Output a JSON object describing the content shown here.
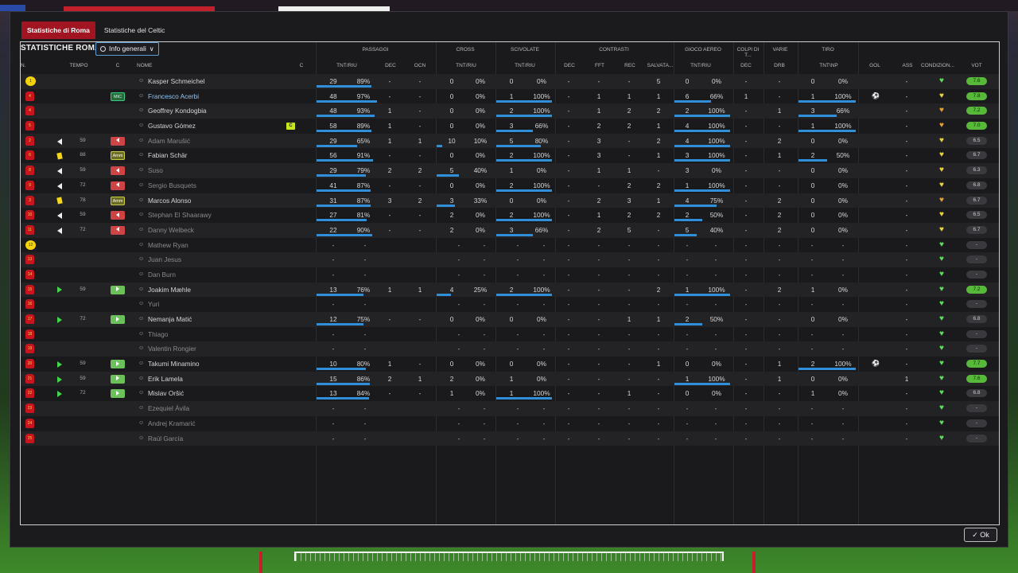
{
  "tabs": [
    {
      "label": "Statistiche di Roma",
      "active": true
    },
    {
      "label": "Statistiche del Celtic",
      "active": false
    }
  ],
  "panel_title": "STATISTICHE ROMA",
  "dropdown_label": "Info generali",
  "groups": {
    "passaggi": "PASSAGGI",
    "cross": "CROSS",
    "scivolate": "SCIVOLATE",
    "contrasti": "CONTRASTI",
    "gioco_aereo": "GIOCO AEREO",
    "colpi": "COLPI DI T...",
    "varie": "VARIE",
    "tiro": "TIRO"
  },
  "columns": {
    "n": "N.",
    "tempo": "TEMPO",
    "c1": "C",
    "nome": "NOME",
    "c2": "C",
    "pas_tnt": "TNT/RIU",
    "pas_dec": "DEC",
    "pas_ocn": "OCN",
    "cross_tnt": "TNT/RIU",
    "sciv_tnt": "TNT/RIU",
    "con_dec": "DEC",
    "con_fft": "FFT",
    "con_rec": "REC",
    "con_salv": "SALVATA...",
    "aer_tnt": "TNT/RIU",
    "colpi_dec": "DEC",
    "varie_drb": "DRB",
    "tiro_tnt": "TNT\\NP",
    "gol": "GOL",
    "ass": "ASS",
    "cond": "CONDIZION...",
    "vot": "VOT"
  },
  "players": [
    {
      "num": "1",
      "gk": true,
      "ev": "",
      "min": "",
      "role": "",
      "name": "Kasper Schmeichel",
      "style": "",
      "cap": "",
      "pas": "29",
      "pasP": "89%",
      "pasFrac": 0.89,
      "pdec": "-",
      "pocn": "-",
      "cr": "0",
      "crP": "0%",
      "crFrac": 0,
      "sc": "0",
      "scP": "0%",
      "scFrac": 0,
      "cdec": "-",
      "fft": "-",
      "rec": "-",
      "salv": "5",
      "aer": "0",
      "aerP": "0%",
      "aerFrac": 0,
      "hdec": "-",
      "drb": "-",
      "tiro": "0",
      "tiroP": "0%",
      "tiroFrac": 0,
      "gol": "",
      "ass": "-",
      "cond": "grn",
      "vot": "7.6",
      "good": true
    },
    {
      "num": "4",
      "gk": false,
      "ev": "",
      "min": "",
      "role": "MIC",
      "roleType": "pos",
      "name": "Francesco Acerbi",
      "style": "link",
      "cap": "",
      "pas": "48",
      "pasP": "97%",
      "pasFrac": 0.97,
      "pdec": "-",
      "pocn": "-",
      "cr": "0",
      "crP": "0%",
      "crFrac": 0,
      "sc": "1",
      "scP": "100%",
      "scFrac": 1,
      "cdec": "-",
      "fft": "1",
      "rec": "1",
      "salv": "1",
      "aer": "6",
      "aerP": "66%",
      "aerFrac": 0.66,
      "hdec": "1",
      "drb": "-",
      "tiro": "1",
      "tiroP": "100%",
      "tiroFrac": 1,
      "gol": "ball",
      "ass": "-",
      "cond": "yel",
      "vot": "7.8",
      "good": true
    },
    {
      "num": "4",
      "gk": false,
      "ev": "",
      "min": "",
      "role": "",
      "name": "Geoffrey Kondogbia",
      "style": "",
      "cap": "",
      "pas": "48",
      "pasP": "93%",
      "pasFrac": 0.93,
      "pdec": "1",
      "pocn": "-",
      "cr": "0",
      "crP": "0%",
      "crFrac": 0,
      "sc": "2",
      "scP": "100%",
      "scFrac": 1,
      "cdec": "-",
      "fft": "1",
      "rec": "2",
      "salv": "2",
      "aer": "2",
      "aerP": "100%",
      "aerFrac": 1,
      "hdec": "-",
      "drb": "1",
      "tiro": "3",
      "tiroP": "66%",
      "tiroFrac": 0.66,
      "gol": "",
      "ass": "-",
      "cond": "org",
      "vot": "7.2",
      "good": true
    },
    {
      "num": "5",
      "gk": false,
      "ev": "",
      "min": "",
      "role": "",
      "name": "Gustavo Gómez",
      "style": "",
      "cap": "C",
      "pas": "58",
      "pasP": "89%",
      "pasFrac": 0.89,
      "pdec": "1",
      "pocn": "-",
      "cr": "0",
      "crP": "0%",
      "crFrac": 0,
      "sc": "3",
      "scP": "66%",
      "scFrac": 0.66,
      "cdec": "-",
      "fft": "2",
      "rec": "2",
      "salv": "1",
      "aer": "4",
      "aerP": "100%",
      "aerFrac": 1,
      "hdec": "-",
      "drb": "-",
      "tiro": "1",
      "tiroP": "100%",
      "tiroFrac": 1,
      "gol": "",
      "ass": "-",
      "cond": "org",
      "vot": "7.0",
      "good": true
    },
    {
      "num": "2",
      "gk": false,
      "ev": "out",
      "min": "59",
      "role": "out",
      "name": "Adam Marušić",
      "style": "dim",
      "cap": "",
      "pas": "29",
      "pasP": "65%",
      "pasFrac": 0.65,
      "pdec": "1",
      "pocn": "1",
      "cr": "10",
      "crP": "10%",
      "crFrac": 0.1,
      "sc": "5",
      "scP": "80%",
      "scFrac": 0.8,
      "cdec": "-",
      "fft": "3",
      "rec": "-",
      "salv": "2",
      "aer": "4",
      "aerP": "100%",
      "aerFrac": 1,
      "hdec": "-",
      "drb": "2",
      "tiro": "0",
      "tiroP": "0%",
      "tiroFrac": 0,
      "gol": "",
      "ass": "-",
      "cond": "yel",
      "vot": "6.5",
      "good": false
    },
    {
      "num": "6",
      "gk": false,
      "ev": "yc",
      "min": "88",
      "role": "Amm",
      "roleType": "amm",
      "name": "Fabian Schär",
      "style": "",
      "cap": "",
      "pas": "56",
      "pasP": "91%",
      "pasFrac": 0.91,
      "pdec": "-",
      "pocn": "-",
      "cr": "0",
      "crP": "0%",
      "crFrac": 0,
      "sc": "2",
      "scP": "100%",
      "scFrac": 1,
      "cdec": "-",
      "fft": "3",
      "rec": "-",
      "salv": "1",
      "aer": "3",
      "aerP": "100%",
      "aerFrac": 1,
      "hdec": "-",
      "drb": "1",
      "tiro": "2",
      "tiroP": "50%",
      "tiroFrac": 0.5,
      "gol": "",
      "ass": "-",
      "cond": "yel",
      "vot": "6.7",
      "good": false
    },
    {
      "num": "8",
      "gk": false,
      "ev": "out",
      "min": "59",
      "role": "out",
      "name": "Suso",
      "style": "dim",
      "cap": "",
      "pas": "29",
      "pasP": "79%",
      "pasFrac": 0.79,
      "pdec": "2",
      "pocn": "2",
      "cr": "5",
      "crP": "40%",
      "crFrac": 0.4,
      "sc": "1",
      "scP": "0%",
      "scFrac": 0,
      "cdec": "-",
      "fft": "1",
      "rec": "1",
      "salv": "-",
      "aer": "3",
      "aerP": "0%",
      "aerFrac": 0,
      "hdec": "-",
      "drb": "-",
      "tiro": "0",
      "tiroP": "0%",
      "tiroFrac": 0,
      "gol": "",
      "ass": "-",
      "cond": "yel",
      "vot": "6.3",
      "good": false
    },
    {
      "num": "9",
      "gk": false,
      "ev": "out",
      "min": "72",
      "role": "out",
      "name": "Sergio Busquets",
      "style": "dim",
      "cap": "",
      "pas": "41",
      "pasP": "87%",
      "pasFrac": 0.87,
      "pdec": "-",
      "pocn": "-",
      "cr": "0",
      "crP": "0%",
      "crFrac": 0,
      "sc": "2",
      "scP": "100%",
      "scFrac": 1,
      "cdec": "-",
      "fft": "-",
      "rec": "2",
      "salv": "2",
      "aer": "1",
      "aerP": "100%",
      "aerFrac": 1,
      "hdec": "-",
      "drb": "-",
      "tiro": "0",
      "tiroP": "0%",
      "tiroFrac": 0,
      "gol": "",
      "ass": "-",
      "cond": "yel",
      "vot": "6.8",
      "good": false
    },
    {
      "num": "3",
      "gk": false,
      "ev": "yc",
      "min": "78",
      "role": "Amm",
      "roleType": "amm",
      "name": "Marcos Alonso",
      "style": "",
      "cap": "",
      "pas": "31",
      "pasP": "87%",
      "pasFrac": 0.87,
      "pdec": "3",
      "pocn": "2",
      "cr": "3",
      "crP": "33%",
      "crFrac": 0.33,
      "sc": "0",
      "scP": "0%",
      "scFrac": 0,
      "cdec": "-",
      "fft": "2",
      "rec": "3",
      "salv": "1",
      "aer": "4",
      "aerP": "75%",
      "aerFrac": 0.75,
      "hdec": "-",
      "drb": "2",
      "tiro": "0",
      "tiroP": "0%",
      "tiroFrac": 0,
      "gol": "",
      "ass": "-",
      "cond": "org",
      "vot": "6.7",
      "good": false
    },
    {
      "num": "10",
      "gk": false,
      "ev": "out",
      "min": "59",
      "role": "out",
      "name": "Stephan El Shaarawy",
      "style": "dim",
      "cap": "",
      "pas": "27",
      "pasP": "81%",
      "pasFrac": 0.81,
      "pdec": "-",
      "pocn": "-",
      "cr": "2",
      "crP": "0%",
      "crFrac": 0,
      "sc": "2",
      "scP": "100%",
      "scFrac": 1,
      "cdec": "-",
      "fft": "1",
      "rec": "2",
      "salv": "2",
      "aer": "2",
      "aerP": "50%",
      "aerFrac": 0.5,
      "hdec": "-",
      "drb": "2",
      "tiro": "0",
      "tiroP": "0%",
      "tiroFrac": 0,
      "gol": "",
      "ass": "-",
      "cond": "yel",
      "vot": "6.5",
      "good": false
    },
    {
      "num": "11",
      "gk": false,
      "ev": "out",
      "min": "72",
      "role": "out",
      "name": "Danny Welbeck",
      "style": "dim",
      "cap": "",
      "pas": "22",
      "pasP": "90%",
      "pasFrac": 0.9,
      "pdec": "-",
      "pocn": "-",
      "cr": "2",
      "crP": "0%",
      "crFrac": 0,
      "sc": "3",
      "scP": "66%",
      "scFrac": 0.66,
      "cdec": "-",
      "fft": "2",
      "rec": "5",
      "salv": "-",
      "aer": "5",
      "aerP": "40%",
      "aerFrac": 0.4,
      "hdec": "-",
      "drb": "2",
      "tiro": "0",
      "tiroP": "0%",
      "tiroFrac": 0,
      "gol": "",
      "ass": "-",
      "cond": "yel",
      "vot": "6.7",
      "good": false
    },
    {
      "num": "12",
      "gk": true,
      "ev": "",
      "min": "",
      "role": "",
      "name": "Mathew Ryan",
      "style": "dim",
      "empty": true,
      "cond": "grn",
      "vot": "-"
    },
    {
      "num": "13",
      "gk": false,
      "ev": "",
      "min": "",
      "role": "",
      "name": "Juan Jesus",
      "style": "dim",
      "empty": true,
      "cond": "grn",
      "vot": "-"
    },
    {
      "num": "14",
      "gk": false,
      "ev": "",
      "min": "",
      "role": "",
      "name": "Dan Burn",
      "style": "dim",
      "empty": true,
      "cond": "grn",
      "vot": "-"
    },
    {
      "num": "15",
      "gk": false,
      "ev": "in",
      "min": "59",
      "role": "in",
      "name": "Joakim Mæhle",
      "style": "",
      "cap": "",
      "pas": "13",
      "pasP": "76%",
      "pasFrac": 0.76,
      "pdec": "1",
      "pocn": "1",
      "cr": "4",
      "crP": "25%",
      "crFrac": 0.25,
      "sc": "2",
      "scP": "100%",
      "scFrac": 1,
      "cdec": "-",
      "fft": "-",
      "rec": "-",
      "salv": "2",
      "aer": "1",
      "aerP": "100%",
      "aerFrac": 1,
      "hdec": "-",
      "drb": "2",
      "tiro": "1",
      "tiroP": "0%",
      "tiroFrac": 0,
      "gol": "",
      "ass": "-",
      "cond": "grn",
      "vot": "7.2",
      "good": true
    },
    {
      "num": "16",
      "gk": false,
      "ev": "",
      "min": "",
      "role": "",
      "name": "Yuri",
      "style": "dim",
      "empty": true,
      "cond": "grn",
      "vot": "-"
    },
    {
      "num": "17",
      "gk": false,
      "ev": "in",
      "min": "72",
      "role": "in",
      "name": "Nemanja Matić",
      "style": "",
      "cap": "",
      "pas": "12",
      "pasP": "75%",
      "pasFrac": 0.75,
      "pdec": "-",
      "pocn": "-",
      "cr": "0",
      "crP": "0%",
      "crFrac": 0,
      "sc": "0",
      "scP": "0%",
      "scFrac": 0,
      "cdec": "-",
      "fft": "-",
      "rec": "1",
      "salv": "1",
      "aer": "2",
      "aerP": "50%",
      "aerFrac": 0.5,
      "hdec": "-",
      "drb": "-",
      "tiro": "0",
      "tiroP": "0%",
      "tiroFrac": 0,
      "gol": "",
      "ass": "-",
      "cond": "grn",
      "vot": "6.8",
      "good": false
    },
    {
      "num": "18",
      "gk": false,
      "ev": "",
      "min": "",
      "role": "",
      "name": "Thiago",
      "style": "dim",
      "empty": true,
      "cond": "grn",
      "vot": "-"
    },
    {
      "num": "19",
      "gk": false,
      "ev": "",
      "min": "",
      "role": "",
      "name": "Valentin Rongier",
      "style": "dim",
      "empty": true,
      "cond": "grn",
      "vot": "-"
    },
    {
      "num": "20",
      "gk": false,
      "ev": "in",
      "min": "59",
      "role": "in",
      "name": "Takumi Minamino",
      "style": "",
      "cap": "",
      "pas": "10",
      "pasP": "80%",
      "pasFrac": 0.8,
      "pdec": "1",
      "pocn": "-",
      "cr": "0",
      "crP": "0%",
      "crFrac": 0,
      "sc": "0",
      "scP": "0%",
      "scFrac": 0,
      "cdec": "-",
      "fft": "-",
      "rec": "-",
      "salv": "1",
      "aer": "0",
      "aerP": "0%",
      "aerFrac": 0,
      "hdec": "-",
      "drb": "1",
      "tiro": "2",
      "tiroP": "100%",
      "tiroFrac": 1,
      "gol": "ball",
      "ass": "-",
      "cond": "grn",
      "vot": "7.7",
      "good": true
    },
    {
      "num": "21",
      "gk": false,
      "ev": "in",
      "min": "59",
      "role": "in",
      "name": "Erik Lamela",
      "style": "",
      "cap": "",
      "pas": "15",
      "pasP": "86%",
      "pasFrac": 0.86,
      "pdec": "2",
      "pocn": "1",
      "cr": "2",
      "crP": "0%",
      "crFrac": 0,
      "sc": "1",
      "scP": "0%",
      "scFrac": 0,
      "cdec": "-",
      "fft": "-",
      "rec": "-",
      "salv": "-",
      "aer": "1",
      "aerP": "100%",
      "aerFrac": 1,
      "hdec": "-",
      "drb": "1",
      "tiro": "0",
      "tiroP": "0%",
      "tiroFrac": 0,
      "gol": "",
      "ass": "1",
      "cond": "grn",
      "vot": "7.6",
      "good": true
    },
    {
      "num": "22",
      "gk": false,
      "ev": "in",
      "min": "72",
      "role": "in",
      "name": "Mislav Oršić",
      "style": "",
      "cap": "",
      "pas": "13",
      "pasP": "84%",
      "pasFrac": 0.84,
      "pdec": "-",
      "pocn": "-",
      "cr": "1",
      "crP": "0%",
      "crFrac": 0,
      "sc": "1",
      "scP": "100%",
      "scFrac": 1,
      "cdec": "-",
      "fft": "-",
      "rec": "1",
      "salv": "-",
      "aer": "0",
      "aerP": "0%",
      "aerFrac": 0,
      "hdec": "-",
      "drb": "-",
      "tiro": "1",
      "tiroP": "0%",
      "tiroFrac": 0,
      "gol": "",
      "ass": "-",
      "cond": "grn",
      "vot": "6.8",
      "good": false
    },
    {
      "num": "23",
      "gk": false,
      "ev": "",
      "min": "",
      "role": "",
      "name": "Ezequiel Ávila",
      "style": "dim",
      "empty": true,
      "cond": "grn",
      "vot": "-"
    },
    {
      "num": "24",
      "gk": false,
      "ev": "",
      "min": "",
      "role": "",
      "name": "Andrej Kramarić",
      "style": "dim",
      "empty": true,
      "cond": "grn",
      "vot": "-"
    },
    {
      "num": "25",
      "gk": false,
      "ev": "",
      "min": "",
      "role": "",
      "name": "Raúl García",
      "style": "dim",
      "empty": true,
      "cond": "grn",
      "vot": "-"
    }
  ],
  "ok_label": "Ok",
  "icons": {
    "dropdown": "eye-icon",
    "player": "person-icon",
    "goal": "ball-icon",
    "condition": "heart-icon",
    "ok": "check-icon"
  },
  "colors": {
    "accent_red": "#a11422",
    "bar_blue": "#2f8fd8",
    "condition_green": "#58e05a",
    "vote_green": "#58b83a"
  }
}
